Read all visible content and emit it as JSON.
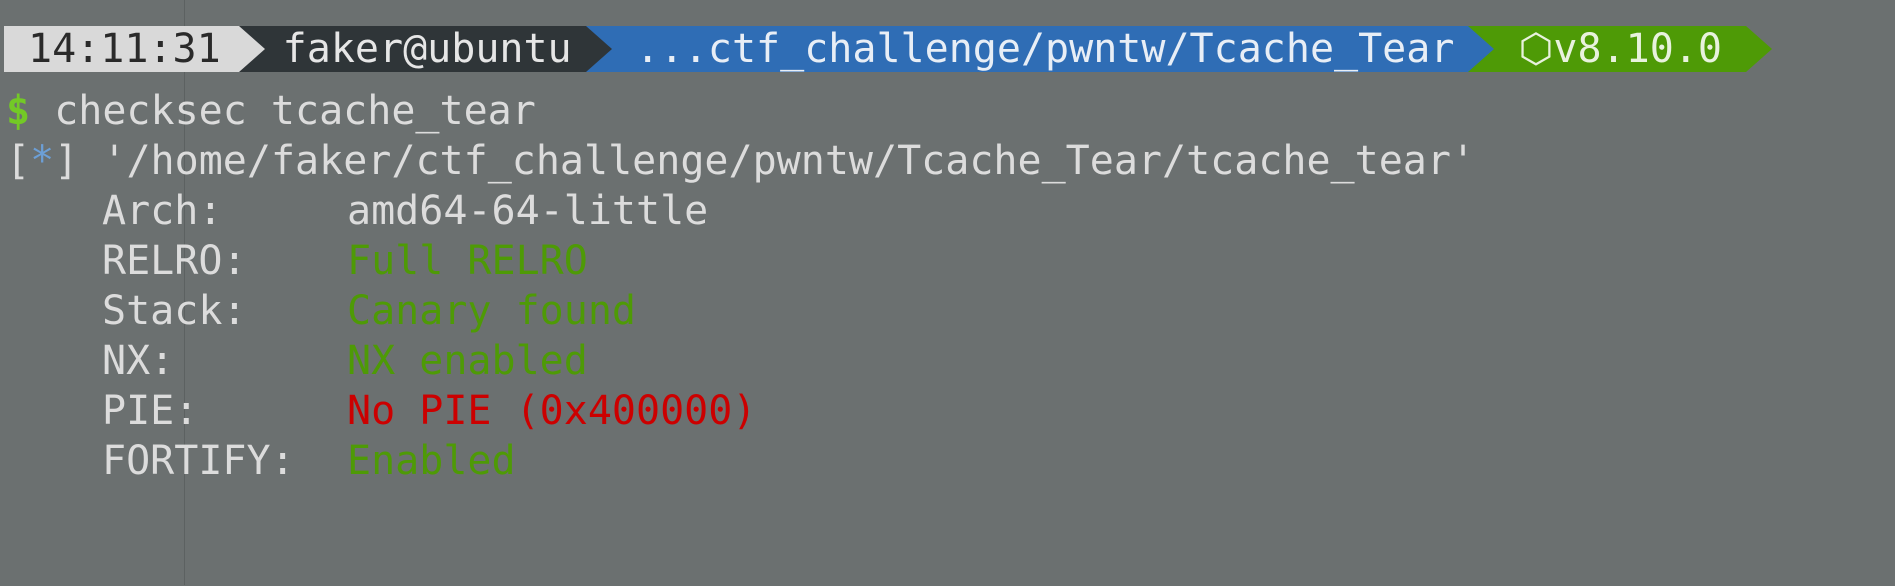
{
  "prompt": {
    "time": "14:11:31",
    "user_host": "faker@ubuntu",
    "path": "...ctf_challenge/pwntw/Tcache_Tear",
    "node_icon": "hexagon-icon",
    "node_version": "v8.10.0"
  },
  "command": {
    "symbol": "$",
    "text": "checksec tcache_tear"
  },
  "info": {
    "open_bracket": "[",
    "star": "*",
    "close_bracket": "]",
    "path": "'/home/faker/ctf_challenge/pwntw/Tcache_Tear/tcache_tear'"
  },
  "checksec": {
    "arch": {
      "label": "Arch:",
      "value": "amd64-64-little"
    },
    "relro": {
      "label": "RELRO:",
      "value": "Full RELRO"
    },
    "stack": {
      "label": "Stack:",
      "value": "Canary found"
    },
    "nx": {
      "label": "NX:",
      "value": "NX enabled"
    },
    "pie": {
      "label": "PIE:",
      "value": "No PIE (0x400000)"
    },
    "fortify": {
      "label": "FORTIFY:",
      "value": "Enabled"
    }
  },
  "colors": {
    "background": "#6b7070",
    "time_segment": "#d9d9d9",
    "user_segment": "#2f3538",
    "path_segment": "#2f6db5",
    "version_segment": "#4e9a06",
    "secure_value": "#4e9a06",
    "insecure_value": "#cc0000"
  }
}
